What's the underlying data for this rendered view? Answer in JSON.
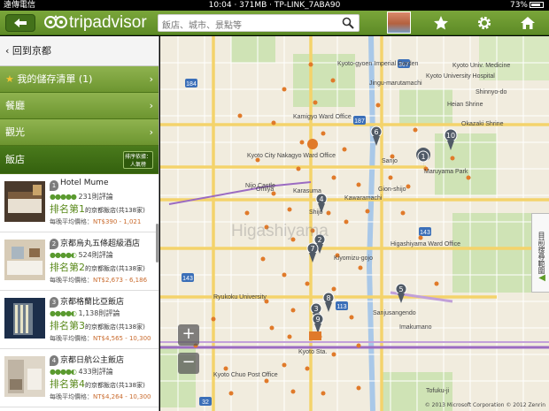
{
  "status": {
    "carrier": "遠傳電信",
    "center": "10:04 · 371MB · TP-LINK_7ABA90",
    "battery": "73%"
  },
  "header": {
    "logo": "tripadvisor",
    "search_placeholder": "飯店、城市、景點等",
    "icons": [
      "back-arrow-icon",
      "search-icon",
      "star-icon",
      "gear-icon",
      "home-icon"
    ]
  },
  "sidebar": {
    "back_label": "回到京都",
    "saved_label": "我的儲存清單 (1)",
    "restaurants_label": "餐廳",
    "sights_label": "觀光",
    "hotels_label": "飯店",
    "sort_label": "排序依據：人氣榜"
  },
  "hotels": [
    {
      "num": "1",
      "name": "Hotel Mume",
      "reviews": "231則評論",
      "rank": "排名第1",
      "rank_of": "的京都飯店(共138家)",
      "price_label": "每晚平均價格：",
      "price": "NT$390 - 1,021"
    },
    {
      "num": "2",
      "name": "京都烏丸五條超級酒店",
      "reviews": "524則評論",
      "rank": "排名第2",
      "rank_of": "的京都飯店(共138家)",
      "price_label": "每晚平均價格：",
      "price": "NT$2,673 - 6,186"
    },
    {
      "num": "3",
      "name": "京都格蘭比亞飯店",
      "reviews": "1,138則評論",
      "rank": "排名第3",
      "rank_of": "的京都飯店(共138家)",
      "price_label": "每晚平均價格：",
      "price": "NT$4,565 - 10,300"
    },
    {
      "num": "4",
      "name": "京都日航公主飯店",
      "reviews": "433則評論",
      "rank": "排名第4",
      "rank_of": "的京都飯店(共138家)",
      "price_label": "每晚平均價格：",
      "price": "NT$4,264 - 10,300"
    }
  ],
  "map": {
    "side_tab": "目前搜尋範圍",
    "copyright": "© 2013 Microsoft Corporation  © 2012 Zenrin",
    "zoom_in": "+",
    "zoom_out": "−",
    "watermark": "Higashiyama",
    "labels": [
      "Kyoto-gyoen Imperial Garden",
      "Kamigyo Ward Office",
      "Kyoto City Nakagyo Ward Office",
      "Nijo Castle",
      "Sanjo",
      "Karasuma",
      "Kawaramachi",
      "Gion-shijo",
      "Shijo",
      "Maruyama Park",
      "Kiyomizu-gojo",
      "Omiya",
      "Kyoto Sta.",
      "Tofuku-ji",
      "Kyoto University Hospital",
      "Heian Shrine",
      "Jingu-marutamachi",
      "Higashiyama Ward Office",
      "Ryukoku University",
      "Kyoto Chuo Post Office",
      "Kyoto Univ. Medicine",
      "Sanjusangendo",
      "Okazaki Shrine",
      "Shinnyo-do",
      "Imakumano"
    ],
    "pins": [
      "1",
      "2",
      "3",
      "4",
      "5",
      "6",
      "7",
      "8",
      "9",
      "10"
    ]
  }
}
